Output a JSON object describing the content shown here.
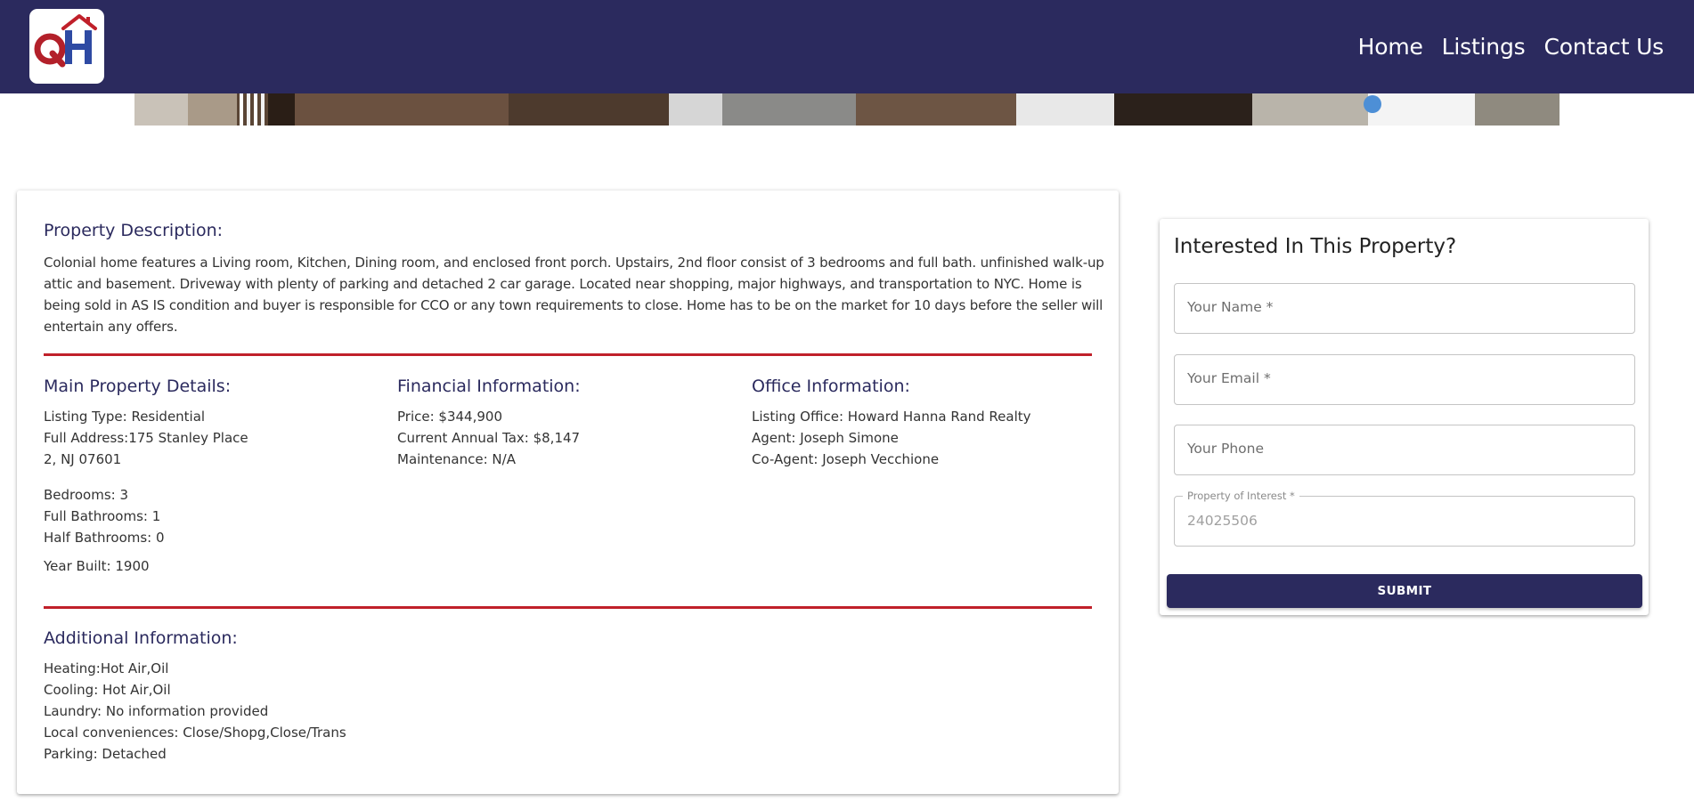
{
  "header": {
    "logo_text": "QH",
    "nav": [
      "Home",
      "Listings",
      "Contact Us"
    ]
  },
  "colors": {
    "navy": "#2b2a5e",
    "accent_red": "#c0202a",
    "logo_blue": "#2e4aa3"
  },
  "description": {
    "title": "Property Description:",
    "text": "Colonial home features a Living room, Kitchen, Dining room, and enclosed front porch. Upstairs, 2nd floor consist of 3 bedrooms and full bath. unfinished walk-up attic and basement. Driveway with plenty of parking and detached 2 car garage. Located near shopping, major highways, and transportation to NYC. Home is being sold in AS IS condition and buyer is responsible for CCO or any town requirements to close. Home has to be on the market for 10 days before the seller will entertain any offers."
  },
  "main_details": {
    "title": "Main Property Details:",
    "listing_type": "Listing Type: Residential",
    "address_line1": "Full Address:175 Stanley Place",
    "address_line2": "2, NJ 07601",
    "bedrooms": "Bedrooms: 3",
    "full_baths": "Full Bathrooms: 1",
    "half_baths": "Half Bathrooms: 0",
    "year_built": "Year Built: 1900"
  },
  "financial": {
    "title": "Financial Information:",
    "price": "Price: $344,900",
    "tax": "Current Annual Tax: $8,147",
    "maintenance": "Maintenance: N/A"
  },
  "office": {
    "title": "Office Information:",
    "listing_office": "Listing Office: Howard Hanna Rand Realty",
    "agent": "Agent: Joseph Simone",
    "co_agent": "Co-Agent: Joseph Vecchione"
  },
  "additional": {
    "title": "Additional Information:",
    "heating": "Heating:Hot Air,Oil",
    "cooling": "Cooling: Hot Air,Oil",
    "laundry": "Laundry: No information provided",
    "conveniences": "Local conveniences: Close/Shopg,Close/Trans",
    "parking": "Parking: Detached"
  },
  "contact_form": {
    "title": "Interested In This Property?",
    "name_placeholder": "Your Name *",
    "email_placeholder": "Your Email *",
    "phone_placeholder": "Your Phone",
    "interest_label": "Property of Interest *",
    "interest_value": "24025506",
    "submit_label": "SUBMIT"
  }
}
